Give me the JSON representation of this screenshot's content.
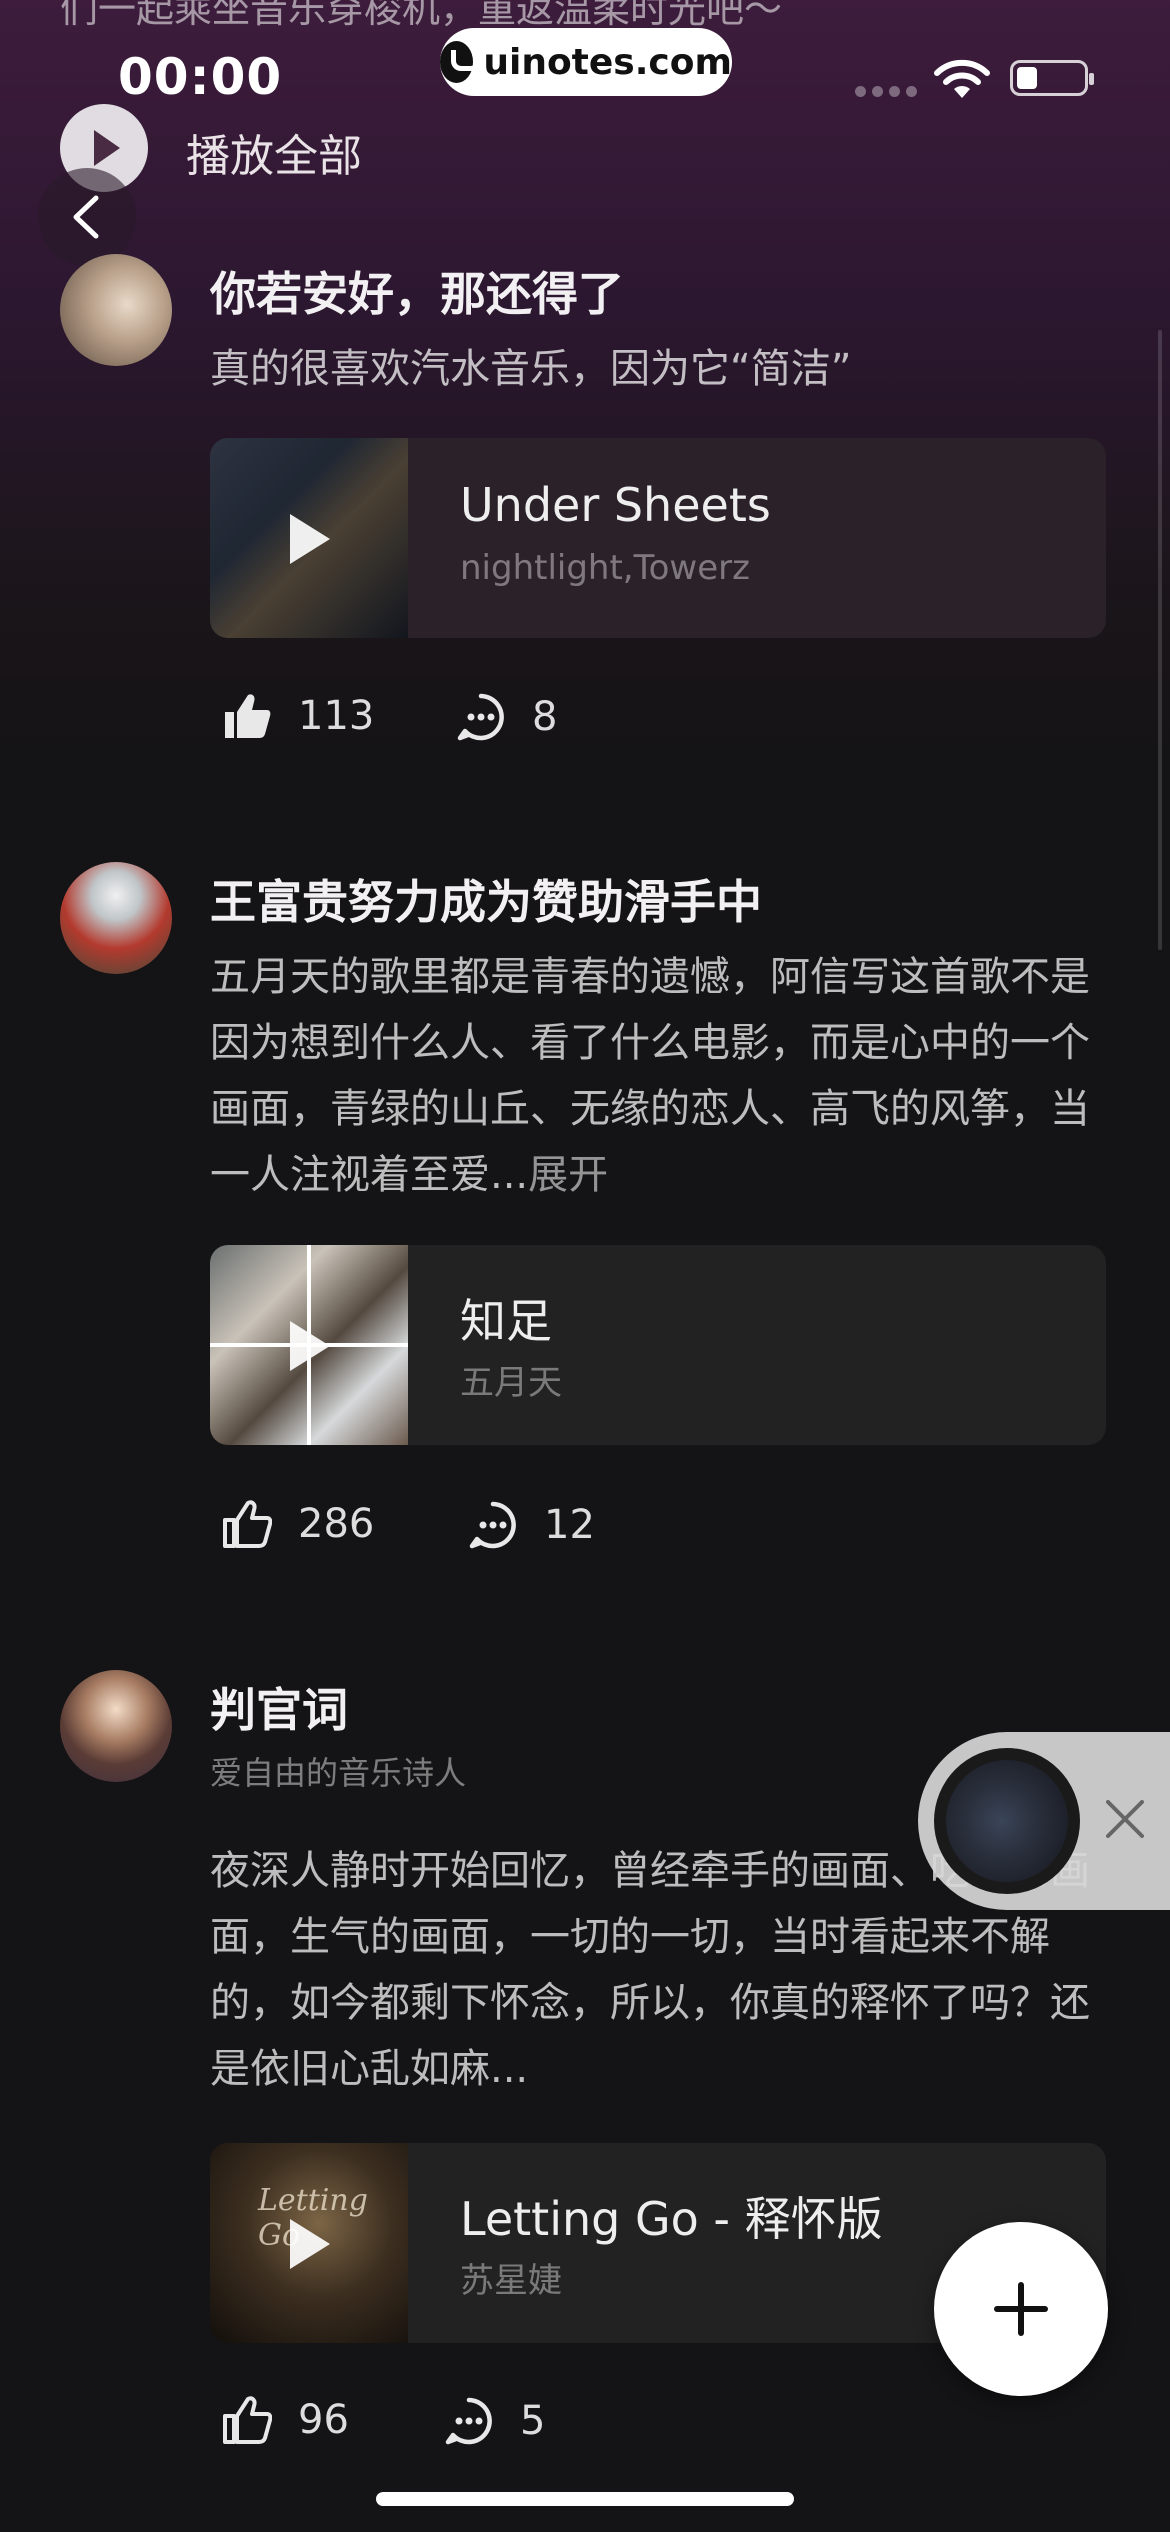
{
  "status_bar": {
    "time": "00:00"
  },
  "watermark": {
    "text": "uinotes.com"
  },
  "header": {
    "intro_text": "们一起乘坐音乐穿梭机，重返温柔时光吧～",
    "play_all_label": "播放全部"
  },
  "posts": [
    {
      "username": "你若安好，那还得了",
      "subtitle": "",
      "text": "真的很喜欢汽水音乐，因为它“简洁”",
      "more": "",
      "song": {
        "title": "Under Sheets",
        "artist": "nightlight,Towerz"
      },
      "likes": "113",
      "comments": "8"
    },
    {
      "username": "王富贵努力成为赞助滑手中",
      "subtitle": "",
      "text": "五月天的歌里都是青春的遗憾，阿信写这首歌不是因为想到什么人、看了什么电影，而是心中的一个画面，青绿的山丘、无缘的恋人、高飞的风筝，当一人注视着至爱...",
      "more": "展开",
      "song": {
        "title": "知足",
        "artist": "五月天"
      },
      "likes": "286",
      "comments": "12"
    },
    {
      "username": "判官词",
      "subtitle": "爱自由的音乐诗人",
      "text": "夜深人静时开始回忆，曾经牵手的画面、吃饭的画面，生气的画面，一切的一切，当时看起来不解的，如今都剩下怀念，所以，你真的释怀了吗？还是依旧心乱如麻...",
      "more": "",
      "cover_script": "Letting Go",
      "song": {
        "title": "Letting Go - 释怀版",
        "artist": "苏星婕"
      },
      "likes": "96",
      "comments": "5"
    }
  ],
  "icons": {
    "back": "chevron-left-icon",
    "play": "play-icon",
    "like": "thumbs-up-icon",
    "comment": "comment-bubble-icon",
    "close": "close-icon",
    "add": "plus-icon"
  },
  "colors": {
    "background": "#141315",
    "header_tint": "#3d1c3c",
    "fab": "#ffffff"
  }
}
